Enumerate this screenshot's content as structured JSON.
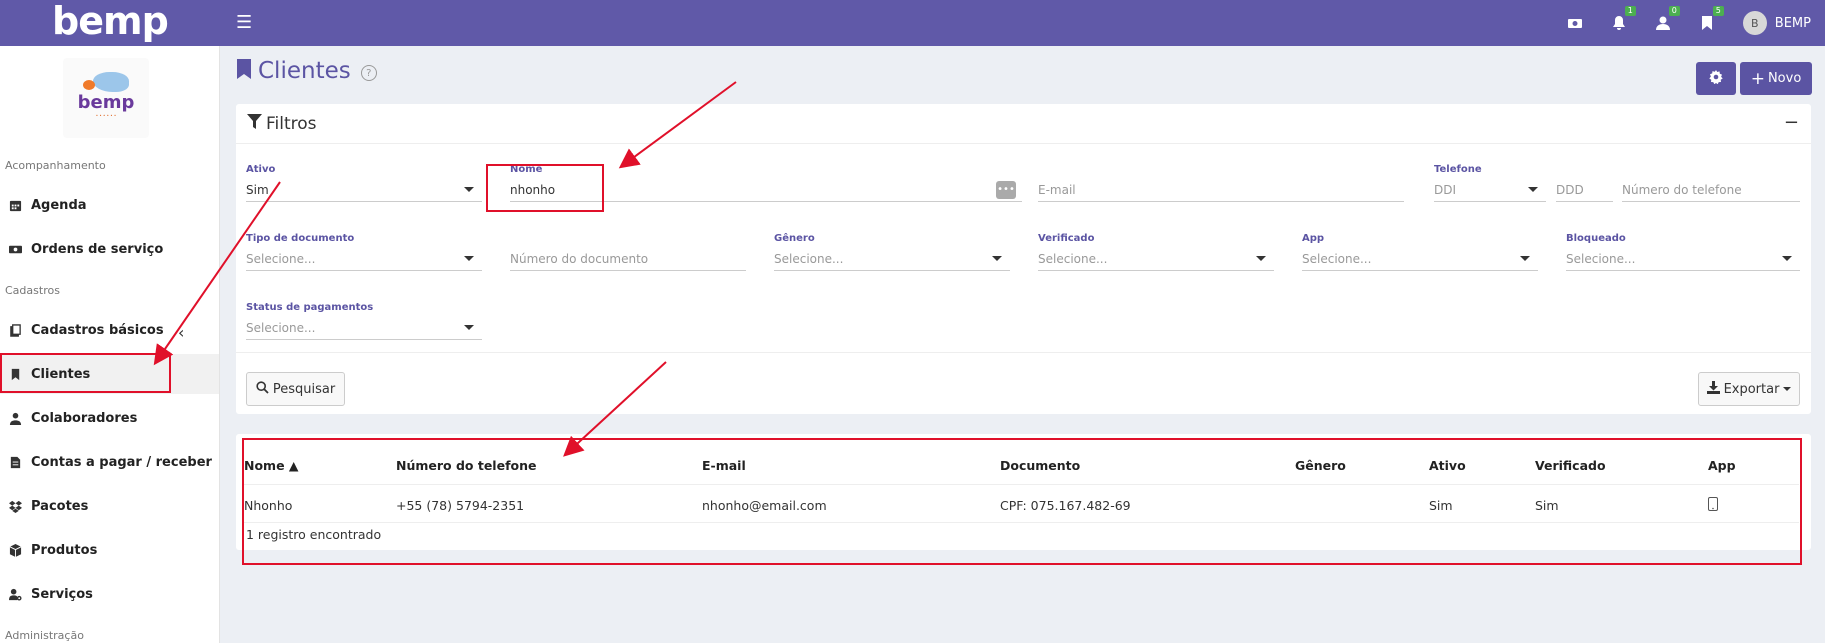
{
  "app": {
    "logo": "bemp",
    "user_initial": "B",
    "user_name": "BEMP"
  },
  "topbar": {
    "badges": {
      "notifications": "1",
      "users": "0",
      "bookmarks": "5"
    },
    "icons": [
      "money-icon",
      "bell-icon",
      "user-icon",
      "bookmark-icon"
    ]
  },
  "sidebar": {
    "sections": [
      "Acompanhamento",
      "Cadastros",
      "Administração"
    ],
    "items": [
      {
        "label": "Agenda",
        "icon": "calendar-icon"
      },
      {
        "label": "Ordens de serviço",
        "icon": "money-icon"
      },
      {
        "label": "Cadastros básicos",
        "icon": "copy-icon"
      },
      {
        "label": "Clientes",
        "icon": "bookmark-icon"
      },
      {
        "label": "Colaboradores",
        "icon": "user-icon"
      },
      {
        "label": "Contas a pagar / receber",
        "icon": "document-icon"
      },
      {
        "label": "Pacotes",
        "icon": "dropbox-icon"
      },
      {
        "label": "Produtos",
        "icon": "box-icon"
      },
      {
        "label": "Serviços",
        "icon": "user-gear-icon"
      }
    ]
  },
  "page": {
    "title": "Clientes",
    "help": "?",
    "new_label": "Novo"
  },
  "filters": {
    "title": "Filtros",
    "ativo": {
      "label": "Ativo",
      "value": "Sim"
    },
    "nome": {
      "label": "Nome",
      "value": "nhonho"
    },
    "email": {
      "placeholder": "E-mail"
    },
    "telefone": {
      "label": "Telefone",
      "ddi": "DDI",
      "ddd": "DDD",
      "numero": "Número do telefone"
    },
    "tipo_documento": {
      "label": "Tipo de documento",
      "value": "Selecione..."
    },
    "numero_documento": {
      "placeholder": "Número do documento"
    },
    "genero": {
      "label": "Gênero",
      "value": "Selecione..."
    },
    "verificado": {
      "label": "Verificado",
      "value": "Selecione..."
    },
    "app": {
      "label": "App",
      "value": "Selecione..."
    },
    "bloqueado": {
      "label": "Bloqueado",
      "value": "Selecione..."
    },
    "status_pagamentos": {
      "label": "Status de pagamentos",
      "value": "Selecione..."
    },
    "search_label": "Pesquisar",
    "export_label": "Exportar"
  },
  "table": {
    "columns": [
      "Nome ▲",
      "Número do telefone",
      "E-mail",
      "Documento",
      "Gênero",
      "Ativo",
      "Verificado",
      "App"
    ],
    "rows": [
      [
        "Nhonho",
        "+55 (78) 5794-2351",
        "nhonho@email.com",
        "CPF: 075.167.482-69",
        "",
        "Sim",
        "Sim",
        ""
      ]
    ],
    "footer": "1 registro encontrado"
  },
  "colors": {
    "brand": "#6059a8",
    "annotation": "#e0102a"
  }
}
